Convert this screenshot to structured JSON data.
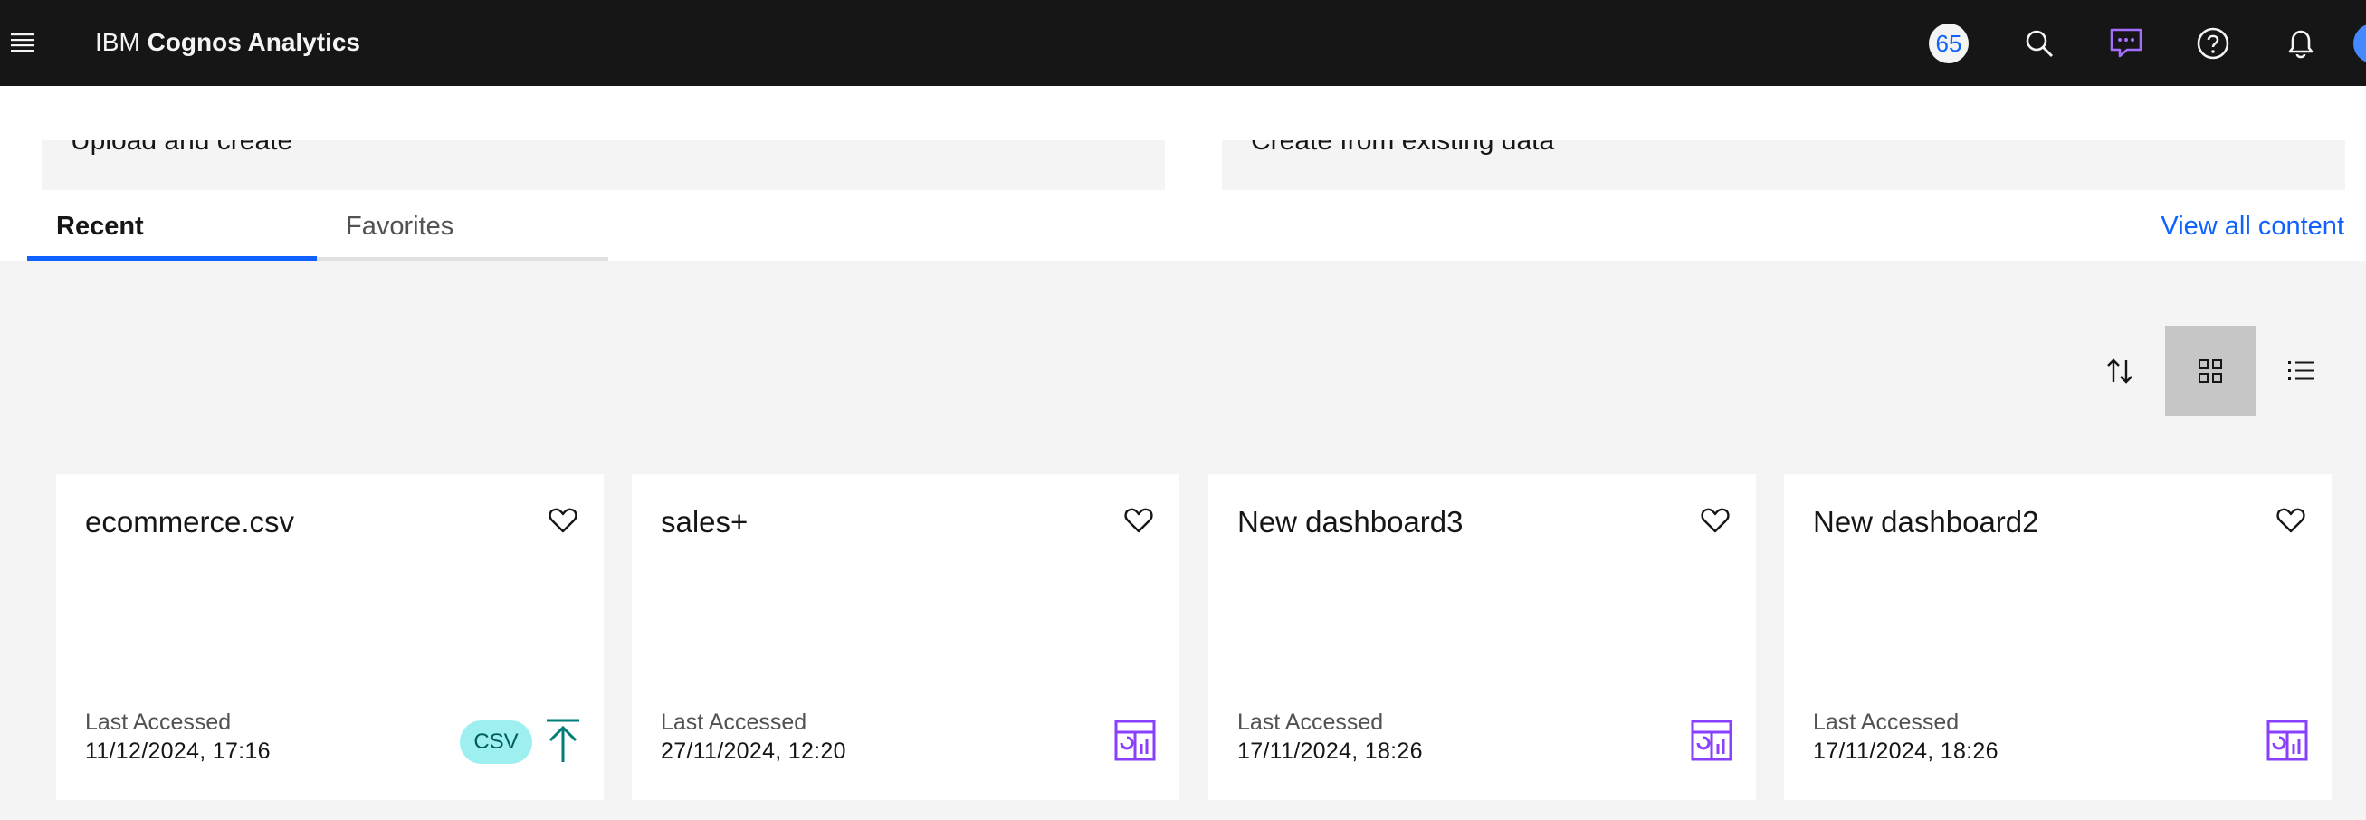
{
  "app": {
    "brand_prefix": "IBM",
    "brand_name": "Cognos Analytics",
    "notification_count": "65"
  },
  "header": {
    "icons": [
      "menu-icon",
      "search-icon",
      "chat-icon",
      "help-icon",
      "notification-icon",
      "avatar"
    ]
  },
  "create": {
    "upload_label": "Upload and create",
    "existing_label": "Create from existing data"
  },
  "tabs": [
    {
      "label": "Recent",
      "active": true
    },
    {
      "label": "Favorites",
      "active": false
    }
  ],
  "view_all_label": "View all content",
  "toolbar": {
    "sort_icon": "sort-icon",
    "grid_icon": "grid-view-icon",
    "list_icon": "list-view-icon",
    "selected_view": "grid"
  },
  "cards": [
    {
      "title": "ecommerce.csv",
      "last_accessed_label": "Last Accessed",
      "last_accessed": "11/12/2024, 17:16",
      "tag": "CSV",
      "type_icon": "upload-icon"
    },
    {
      "title": "sales+",
      "last_accessed_label": "Last Accessed",
      "last_accessed": "27/11/2024, 12:20",
      "type_icon": "dashboard-icon"
    },
    {
      "title": "New dashboard3",
      "last_accessed_label": "Last Accessed",
      "last_accessed": "17/11/2024, 18:26",
      "type_icon": "dashboard-icon"
    },
    {
      "title": "New dashboard2",
      "last_accessed_label": "Last Accessed",
      "last_accessed": "17/11/2024, 18:26",
      "type_icon": "dashboard-icon"
    }
  ],
  "colors": {
    "accent": "#0f62fe",
    "header_bg": "#161616",
    "dashboard_icon": "#8a3ffc",
    "upload_icon": "#007d79",
    "csv_tag_bg": "#9ef0f0"
  }
}
